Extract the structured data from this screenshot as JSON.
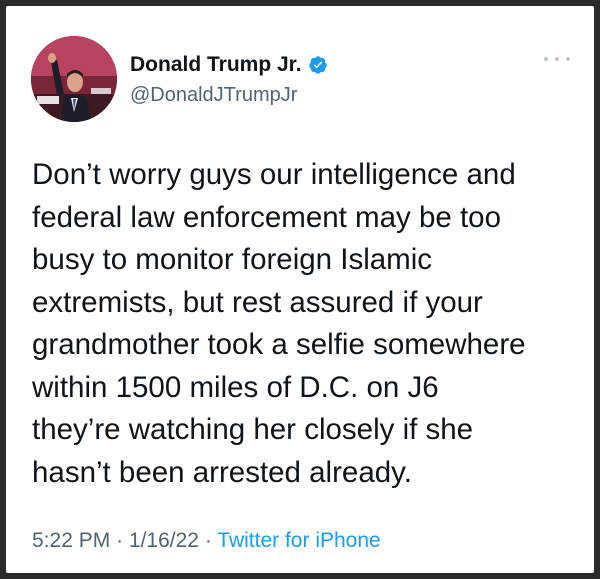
{
  "tweet": {
    "display_name": "Donald Trump Jr.",
    "handle": "@DonaldJTrumpJr",
    "verified": true,
    "text": "Don’t worry guys our intelligence and\nfederal law enforcement may be too\nbusy to monitor foreign Islamic\nextremists, but rest assured if your\ngrandmother took a selfie somewhere\nwithin 1500 miles of D.C. on J6\nthey’re watching her closely if she\nhasn’t been arrested already.",
    "time": "5:22 PM",
    "separator": "·",
    "date": "1/16/22",
    "source": "Twitter for iPhone"
  },
  "colors": {
    "text": "#0f1419",
    "secondary": "#536471",
    "link": "#1d9bf0",
    "verified": "#1d9bf0"
  },
  "icons": {
    "verified": "verified-badge-icon",
    "more": "more-dots-icon"
  }
}
